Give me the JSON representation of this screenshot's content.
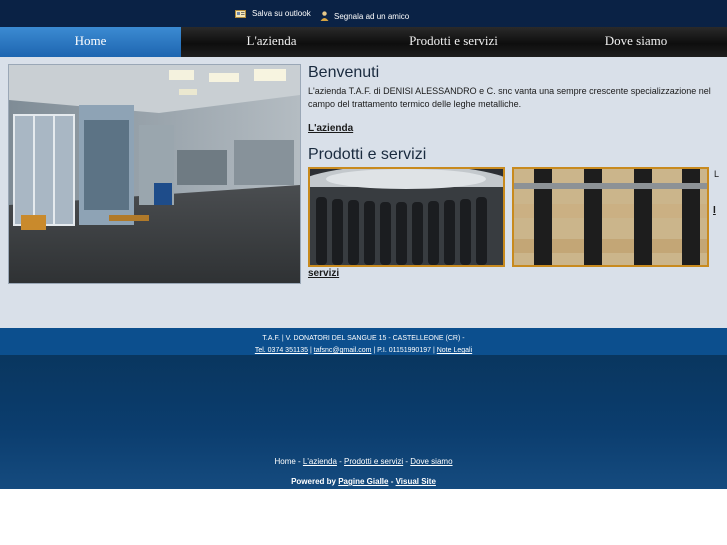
{
  "topbar": {
    "save_outlook": "Salva su outlook",
    "recommend": "Segnala ad un amico",
    "save_icon": "contact-card-icon",
    "recommend_icon": "person-icon"
  },
  "nav": {
    "items": [
      {
        "label": "Home",
        "active": true
      },
      {
        "label": "L'azienda"
      },
      {
        "label": "Prodotti e servizi"
      },
      {
        "label": "Dove siamo"
      }
    ],
    "active_color": "#2a78c4"
  },
  "main": {
    "welcome_title": "Benvenuti",
    "welcome_text": "L'azienda T.A.F. di DENISI ALESSANDRO e C. snc vanta una sempre crescente specializzazione nel campo del trattamento termico delle leghe metalliche.",
    "company_link": "L'azienda",
    "products_title": "Prodotti e servizi",
    "right_letter": "L",
    "right_bold": "I",
    "services_link": "servizi"
  },
  "footer": {
    "address": "T.A.F. | V. DONATORI DEL SANGUE 15 - CASTELLEONE (CR) -",
    "tel": "Tel. 0374 351135",
    "email": "tafsnc@gmail.com",
    "piva": "P.I. 01151990197",
    "legal": "Note Legali",
    "sep": " | ",
    "links": {
      "home": "Home",
      "azienda": "L'azienda",
      "prodotti": "Prodotti e servizi",
      "dove": "Dove siamo",
      "dash": " - "
    },
    "powered_label": "Powered by",
    "pagine_gialle": "Pagine Gialle",
    "visual_site": "Visual Site"
  },
  "colors": {
    "topbar": "#0a2245",
    "content_bg": "#d9e0e9",
    "footer_band": "#0c4f8e",
    "thumb_border": "#c88a1e"
  }
}
